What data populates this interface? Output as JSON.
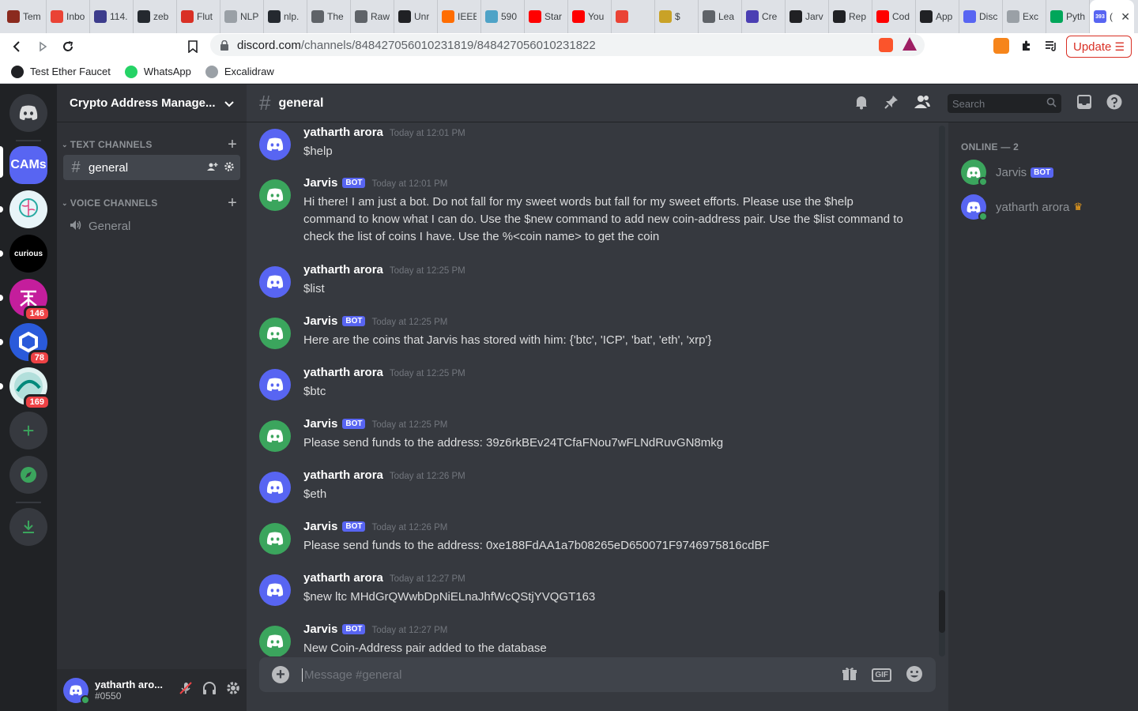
{
  "browser": {
    "tabs": [
      {
        "label": "Tem",
        "color": "#8b2a1e"
      },
      {
        "label": "Inbo",
        "color": "#ea4335"
      },
      {
        "label": "114.",
        "color": "#3c3c8c"
      },
      {
        "label": "zeb",
        "color": "#24292f"
      },
      {
        "label": "Flut",
        "color": "#d93025"
      },
      {
        "label": "NLP",
        "color": "#9aa0a6"
      },
      {
        "label": "nlp.",
        "color": "#24292f"
      },
      {
        "label": "The",
        "color": "#5f6368"
      },
      {
        "label": "Raw",
        "color": "#5f6368"
      },
      {
        "label": "Unr",
        "color": "#202124"
      },
      {
        "label": "IEEE",
        "color": "#ff6d00"
      },
      {
        "label": "590",
        "color": "#4fa3c7"
      },
      {
        "label": "Star",
        "color": "#ff0000"
      },
      {
        "label": "You",
        "color": "#ff0000"
      },
      {
        "label": "",
        "color": "#ea4335"
      },
      {
        "label": "$",
        "color": "#c9a227"
      },
      {
        "label": "Lea",
        "color": "#5f6368"
      },
      {
        "label": "Cre",
        "color": "#4b3fb3"
      },
      {
        "label": "Jarv",
        "color": "#202124"
      },
      {
        "label": "Rep",
        "color": "#202124"
      },
      {
        "label": "Cod",
        "color": "#ff0000"
      },
      {
        "label": "App",
        "color": "#202124"
      },
      {
        "label": "Disc",
        "color": "#5865f2"
      },
      {
        "label": "Exc",
        "color": "#9aa0a6"
      },
      {
        "label": "Pyth",
        "color": "#00a65a"
      }
    ],
    "active_tab": {
      "label": "(",
      "badge": "393"
    },
    "url_host": "discord.com",
    "url_path": "/channels/848427056010231819/848427056010231822",
    "update_label": "Update",
    "bookmarks": [
      {
        "label": "Test Ether Faucet",
        "color": "#202124"
      },
      {
        "label": "WhatsApp",
        "color": "#25d366"
      },
      {
        "label": "Excalidraw",
        "color": "#9aa0a6"
      }
    ]
  },
  "guilds": [
    {
      "label": "CAMs",
      "color": "#5865f2",
      "badge": ""
    },
    {
      "label": "",
      "color": "#e8f4f8",
      "badge": ""
    },
    {
      "label": "curious",
      "color": "#000000",
      "badge": ""
    },
    {
      "label": "",
      "color": "#c41e9c",
      "badge": "146"
    },
    {
      "label": "",
      "color": "#2a5ada",
      "badge": "78"
    },
    {
      "label": "",
      "color": "#e0f2f1",
      "badge": "169"
    }
  ],
  "server": {
    "name": "Crypto Address Manage...",
    "text_category": "TEXT CHANNELS",
    "voice_category": "VOICE CHANNELS",
    "text_channel": "general",
    "voice_channel": "General"
  },
  "user": {
    "name": "yatharth aro...",
    "tag": "#0550"
  },
  "channel": {
    "name": "general",
    "placeholder": "Message #general",
    "search_placeholder": "Search"
  },
  "messages": [
    {
      "author": "yatharth arora",
      "bot": false,
      "time": "Today at 12:01 PM",
      "text": "$help"
    },
    {
      "author": "Jarvis",
      "bot": true,
      "time": "Today at 12:01 PM",
      "text": "Hi there! I am just a bot. Do not fall for my sweet words but fall for my sweet efforts. Please use the $help command to know what I can do. Use the $new command to add new coin-address pair. Use the $list command to check the list of coins I have. Use the %<coin name> to get the coin"
    },
    {
      "author": "yatharth arora",
      "bot": false,
      "time": "Today at 12:25 PM",
      "text": "$list"
    },
    {
      "author": "Jarvis",
      "bot": true,
      "time": "Today at 12:25 PM",
      "text": "Here are the coins that Jarvis has stored with him: {'btc', 'ICP', 'bat', 'eth', 'xrp'}"
    },
    {
      "author": "yatharth arora",
      "bot": false,
      "time": "Today at 12:25 PM",
      "text": "$btc"
    },
    {
      "author": "Jarvis",
      "bot": true,
      "time": "Today at 12:25 PM",
      "text": "Please send funds to the address: 39z6rkBEv24TCfaFNou7wFLNdRuvGN8mkg"
    },
    {
      "author": "yatharth arora",
      "bot": false,
      "time": "Today at 12:26 PM",
      "text": "$eth"
    },
    {
      "author": "Jarvis",
      "bot": true,
      "time": "Today at 12:26 PM",
      "text": "Please send funds to the address: 0xe188FdAA1a7b08265eD650071F9746975816cdBF"
    },
    {
      "author": "yatharth arora",
      "bot": false,
      "time": "Today at 12:27 PM",
      "text": "$new ltc MHdGrQWwbDpNiELnaJhfWcQStjYVQGT163"
    },
    {
      "author": "Jarvis",
      "bot": true,
      "time": "Today at 12:27 PM",
      "text": "New Coin-Address pair added to the database"
    }
  ],
  "bot_tag": "BOT",
  "members": {
    "header": "ONLINE — 2",
    "list": [
      {
        "name": "Jarvis",
        "bot": true,
        "owner": false
      },
      {
        "name": "yatharth arora",
        "bot": false,
        "owner": true
      }
    ]
  },
  "colors": {
    "blurple": "#5865f2",
    "green": "#3ba55d",
    "red_badge": "#ed4245",
    "bg_main": "#36393f"
  }
}
